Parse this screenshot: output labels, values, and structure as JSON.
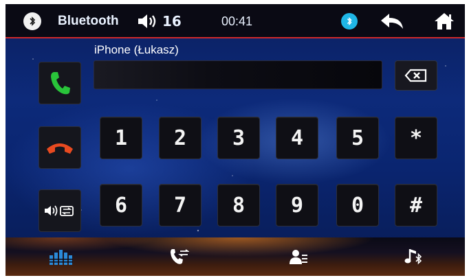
{
  "status": {
    "title": "Bluetooth",
    "volume": "16",
    "time": "00:41"
  },
  "call": {
    "caller_name": "iPhone (Łukasz)",
    "dial_value": ""
  },
  "keypad": {
    "keys": [
      "1",
      "2",
      "3",
      "4",
      "5",
      "*",
      "6",
      "7",
      "8",
      "9",
      "0",
      "#"
    ]
  },
  "colors": {
    "status_bar": "#0a0a14",
    "accent_red": "#d02a2a",
    "answer_green": "#29c43a",
    "hangup_red": "#e84a20",
    "bluetooth_cyan": "#1fb6e6",
    "bottom_icon_blue": "#2a8ad8"
  },
  "icons": {
    "status_left": "bluetooth-icon",
    "volume": "speaker-icon",
    "status_bluetooth": "bluetooth-icon",
    "back": "back-arrow-icon",
    "home": "home-icon",
    "answer": "phone-answer-icon",
    "hangup": "phone-hangup-icon",
    "audio_switch": "audio-switch-icon",
    "backspace": "backspace-icon",
    "dialpad": "dialpad-icon",
    "call_log": "call-log-icon",
    "contacts": "contacts-icon",
    "music": "bluetooth-music-icon"
  }
}
